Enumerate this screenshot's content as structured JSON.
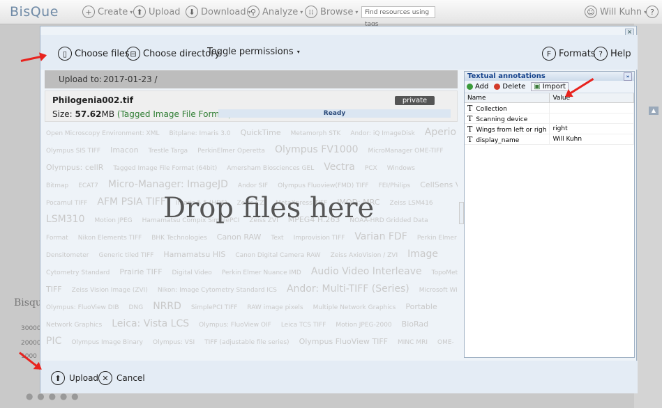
{
  "topbar": {
    "logo": "BisQue",
    "create": "Create",
    "upload": "Upload",
    "download": "Download",
    "analyze": "Analyze",
    "browse": "Browse",
    "search_placeholder": "Find resources using tags",
    "user": "Will Kuhn"
  },
  "background": {
    "left_label": "Bisqu",
    "nums": [
      "30000",
      "20000",
      "1000"
    ]
  },
  "toolbar": {
    "choose_files": "Choose files",
    "choose_directory": "Choose directory",
    "toggle_permissions": "Toggle permissions",
    "formats": "Formats",
    "help": "Help"
  },
  "upload_to": {
    "label": "Upload to:",
    "path": "2017-01-23 /"
  },
  "file": {
    "name": "Philogenia002.tif",
    "size_label": "Size:",
    "size_value": "57.62",
    "size_unit": "MB",
    "format": "(Tagged Image File Format)",
    "permission": "private",
    "status": "Ready"
  },
  "dropzone": {
    "text": "Drop files here",
    "formats": [
      [
        "Open Microscopy Environment: XML",
        "Bitplane: Imaris 3.0",
        "QuickTime",
        "Metamorph STK",
        "Andor: iQ ImageDisk",
        "Aperio"
      ],
      [
        "Olympus SIS TIFF",
        "Imacon",
        "Trestle Targa",
        "PerkinElmer Operetta",
        "Olympus FV1000",
        "MicroManager OME-TIFF"
      ],
      [
        "Olympus: cellR",
        "Tagged Image File Format (64bit)",
        "Amersham Biosciences GEL",
        "Vectra",
        "PCX",
        "Windows"
      ],
      [
        "Bitmap",
        "ECAT7",
        "Micro-Manager: ImageJD",
        "Andor SIF",
        "Olympus Fluoview(FMD) TIFF",
        "FEI/Philips",
        "CellSens VSI"
      ],
      [
        "Pocamul TIFF",
        "AFM PSIA TIFF",
        "Imaris 5.5 (HDF)",
        "Zeiss CZI",
        "MetaXpress TIFF",
        "IMOD: MRC",
        "Zeiss LSM416"
      ],
      [
        "LSM310",
        "Motion JPEG",
        "Hamamatsu Compix SimplePCI",
        "Zeiss ZVI",
        "MPEG4 H.263",
        "NOAA-HRD Gridded Data"
      ],
      [
        "Format",
        "Nikon Elements TIFF",
        "BHK Technologies",
        "Canon RAW",
        "Text",
        "Improvision TIFF",
        "Varian FDF",
        "Perkin Elmer"
      ],
      [
        "Densitometer",
        "Generic tiled TIFF",
        "Hamamatsu HIS",
        "Canon Digital Camera RAW",
        "Zeiss AxioVision / ZVI",
        "Image"
      ],
      [
        "Cytometry Standard",
        "Prairie TIFF",
        "Digital Video",
        "Perkin Elmer Nuance IMD",
        "Audio Video Interleave",
        "TopoMetrix",
        "OME-"
      ],
      [
        "TIFF",
        "Zeiss Vision Image (ZVI)",
        "Nikon: Image Cytometry Standard ICS",
        "Andor: Multi-TIFF (Series)",
        "Microsoft Windows AVI"
      ],
      [
        "Olympus: FluoView DIB",
        "DNG",
        "NRRD",
        "SimplePCI TIFF",
        "RAW image pixels",
        "Multiple Network Graphics",
        "Portable"
      ],
      [
        "Network Graphics",
        "Leica: Vista LCS",
        "Olympus: FluoView OIF",
        "Leica TCS TIFF",
        "Motion JPEG-2000",
        "BioRad"
      ],
      [
        "PIC",
        "Olympus Image Binary",
        "Olympus: VSI",
        "TIFF (adjustable file series)",
        "Olympus FluoView TIFF",
        "MINC MRI",
        "OME-"
      ]
    ]
  },
  "annotations": {
    "title": "Textual annotations",
    "add": "Add",
    "delete": "Delete",
    "import": "Import",
    "col_name": "Name",
    "col_value": "Value",
    "rows": [
      {
        "name": "Collection",
        "value": ""
      },
      {
        "name": "Scanning device",
        "value": ""
      },
      {
        "name": "Wings from left or righ",
        "value": "right"
      },
      {
        "name": "display_name",
        "value": "Will Kuhn"
      }
    ]
  },
  "bottom": {
    "upload": "Upload",
    "cancel": "Cancel"
  },
  "colors": {
    "accent": "#15428b",
    "arrow": "#e8231e",
    "ready": "#dbe6f2",
    "green_text": "#2e7d32"
  }
}
